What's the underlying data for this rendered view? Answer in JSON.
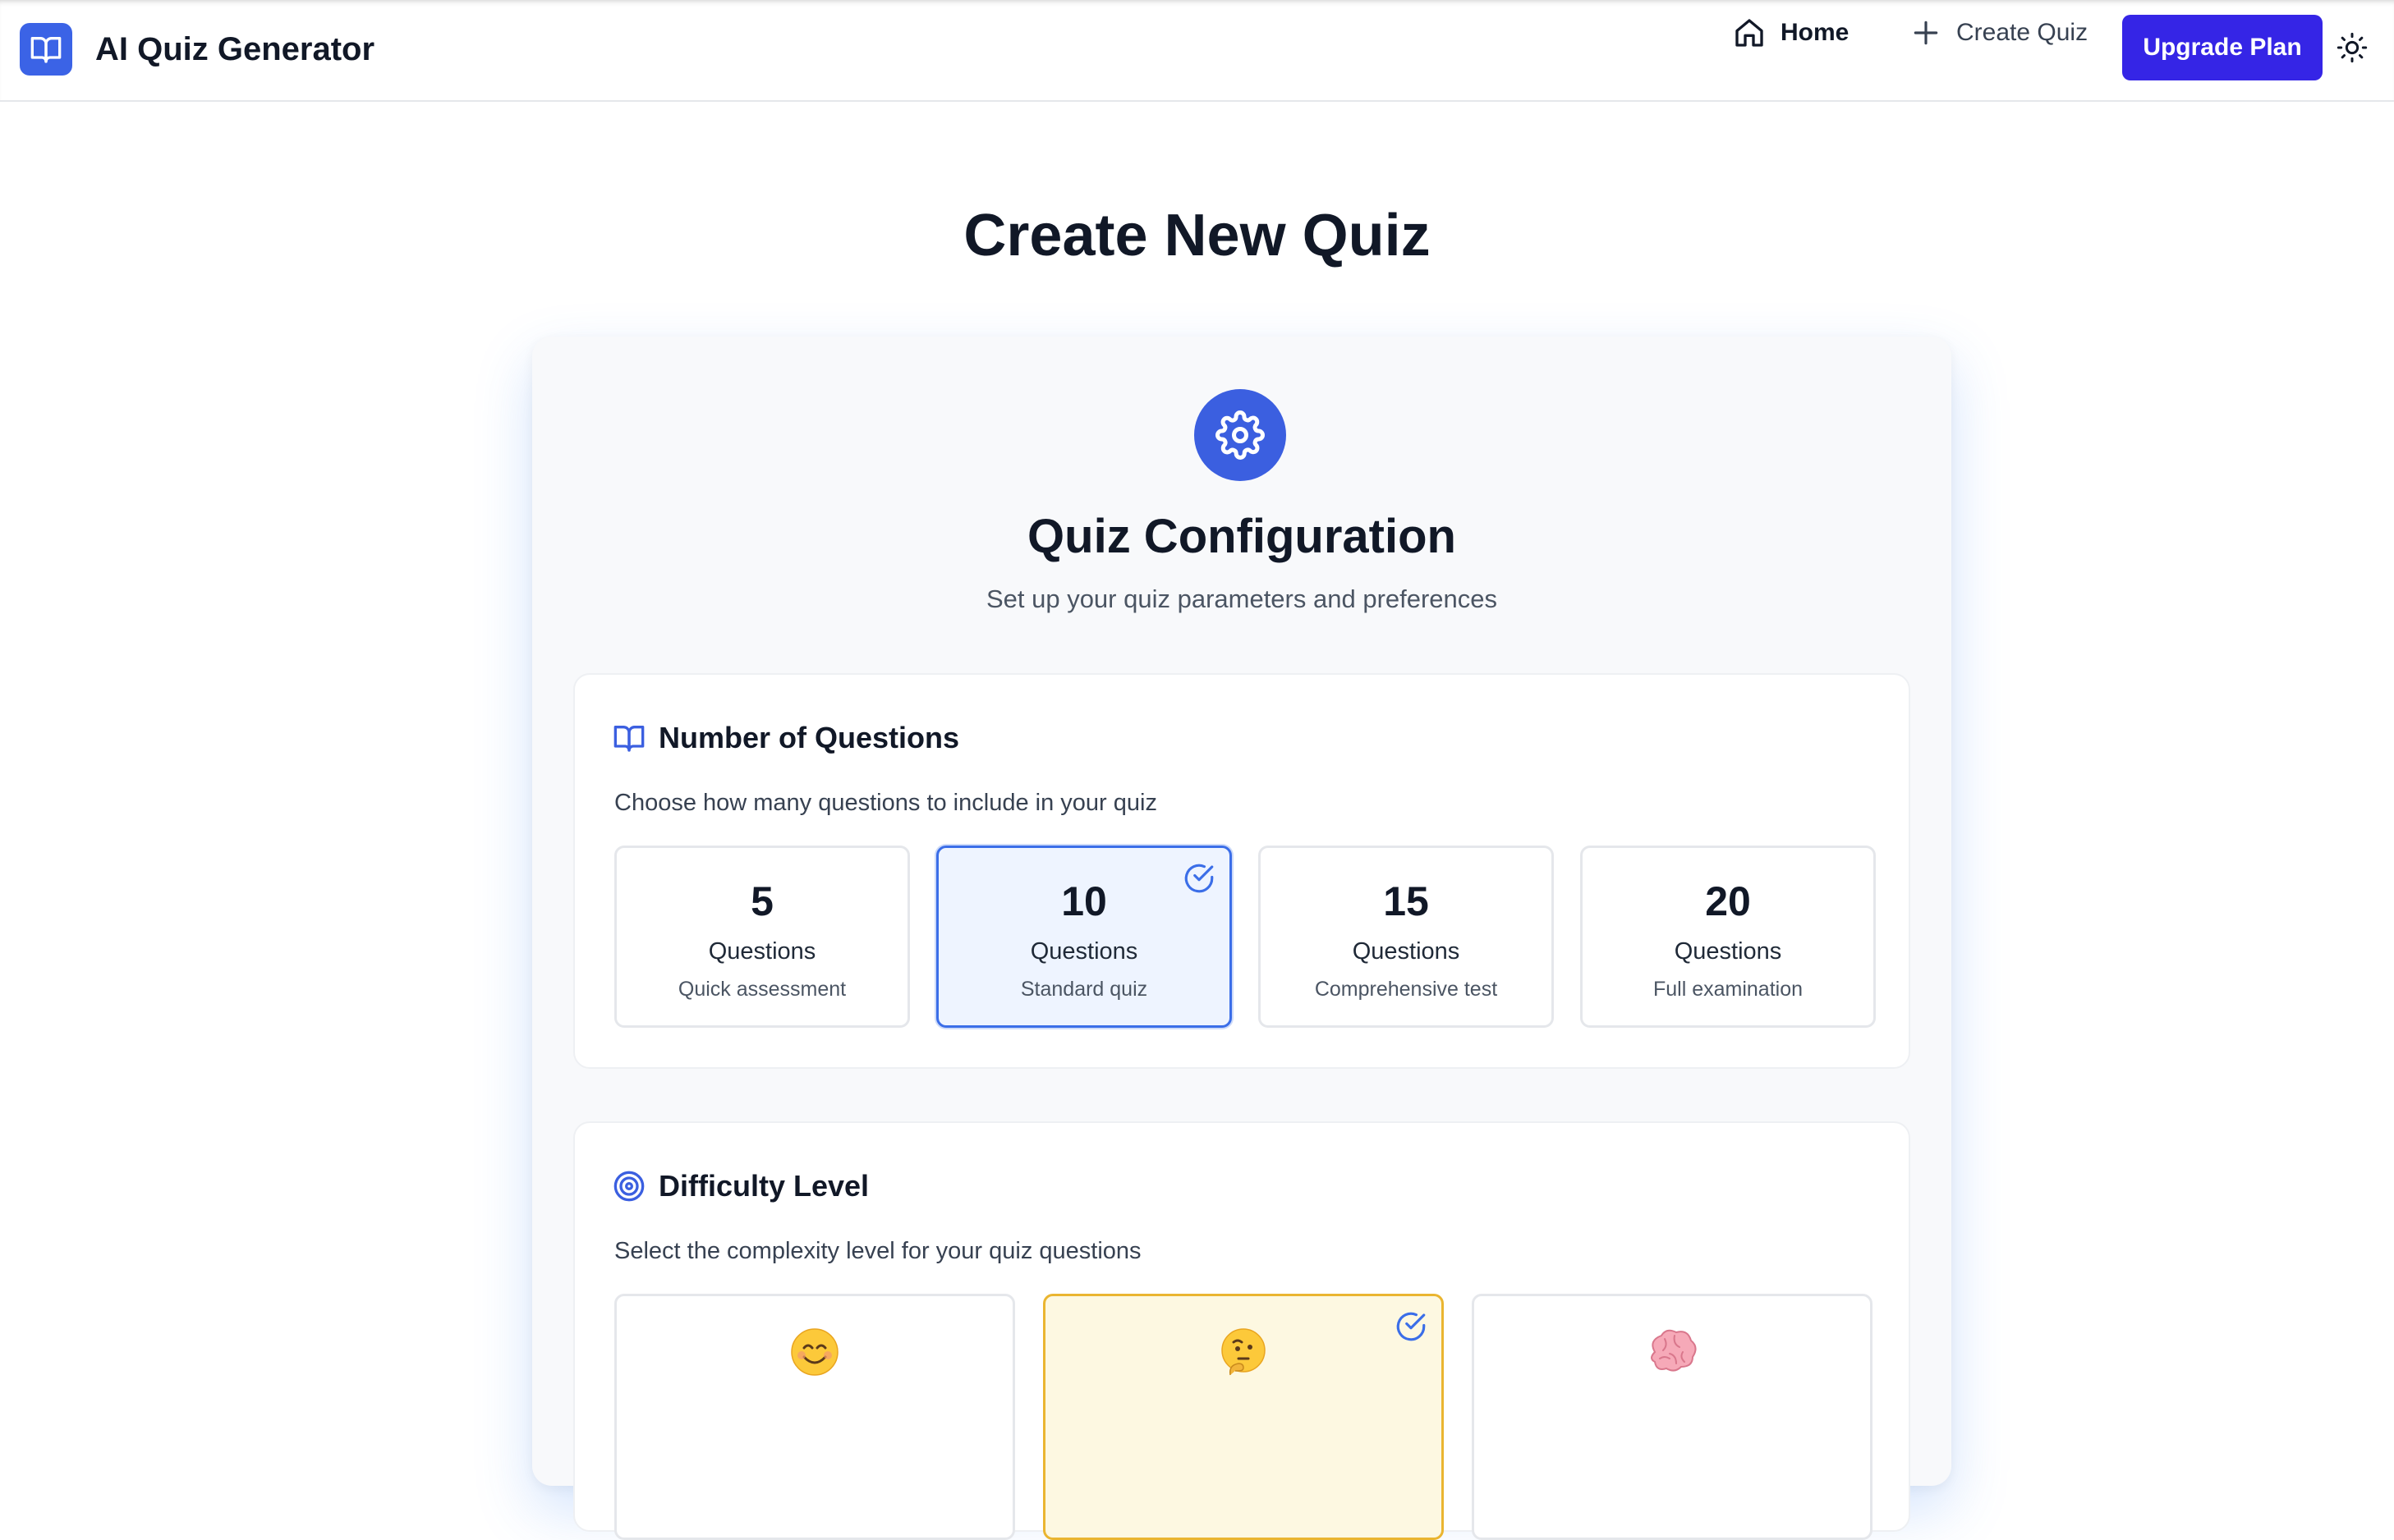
{
  "header": {
    "app_title": "AI Quiz Generator",
    "nav": {
      "home_label": "Home",
      "create_label": "Create Quiz"
    },
    "upgrade_label": "Upgrade Plan"
  },
  "page": {
    "title": "Create New Quiz"
  },
  "config": {
    "title": "Quiz Configuration",
    "subtitle": "Set up your quiz parameters and preferences"
  },
  "questions_section": {
    "title": "Number of Questions",
    "description": "Choose how many questions to include in your quiz",
    "options": [
      {
        "count": "5",
        "label": "Questions",
        "note": "Quick assessment",
        "selected": false
      },
      {
        "count": "10",
        "label": "Questions",
        "note": "Standard quiz",
        "selected": true
      },
      {
        "count": "15",
        "label": "Questions",
        "note": "Comprehensive test",
        "selected": false
      },
      {
        "count": "20",
        "label": "Questions",
        "note": "Full examination",
        "selected": false
      }
    ]
  },
  "difficulty_section": {
    "title": "Difficulty Level",
    "description": "Select the complexity level for your quiz questions",
    "options": [
      {
        "icon": "smiling-face-icon",
        "selected": false
      },
      {
        "icon": "thinking-face-icon",
        "selected": true
      },
      {
        "icon": "brain-icon",
        "selected": false
      }
    ]
  },
  "colors": {
    "primary": "#3b5fe0",
    "upgrade": "#3525e6",
    "selected_question_border": "#3b6ee8",
    "selected_question_bg": "#eef4ff",
    "selected_difficulty_border": "#eab530",
    "selected_difficulty_bg": "#fdf8e1"
  }
}
